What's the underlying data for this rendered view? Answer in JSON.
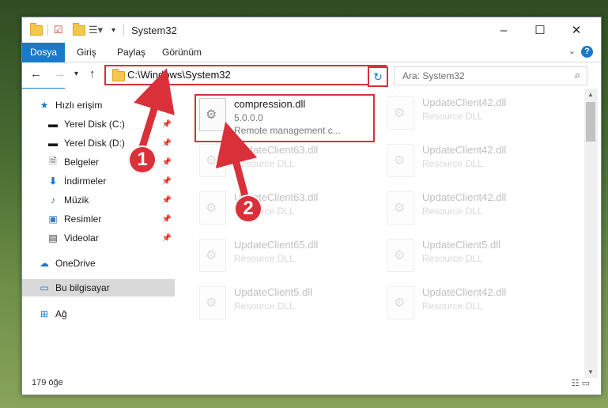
{
  "window": {
    "title": "System32",
    "controls": {
      "minimize": "–",
      "maximize": "☐",
      "close": "✕"
    }
  },
  "ribbon": {
    "tabs": [
      "Dosya",
      "Giriş",
      "Paylaş",
      "Görünüm"
    ],
    "help": "?",
    "collapse": "⌄"
  },
  "address": {
    "path": "C:\\Windows\\System32",
    "search_placeholder": "Ara: System32"
  },
  "nav": {
    "quick_access": "Hızlı erişim",
    "items": [
      "Yerel Disk (C:)",
      "Yerel Disk (D:)",
      "Belgeler",
      "İndirmeler",
      "Müzik",
      "Resimler",
      "Videolar"
    ],
    "onedrive": "OneDrive",
    "this_pc": "Bu bilgisayar",
    "network": "Ağ"
  },
  "files": {
    "selected": {
      "name": "compression.dll",
      "version": "5.0.0.0",
      "description": "Remote management c..."
    },
    "left_column": [
      {
        "name": "UpdateClient63.dll",
        "desc": "Resource DLL"
      },
      {
        "name": "UpdateClient63.dll",
        "desc": "Resource DLL"
      },
      {
        "name": "UpdateClient65.dll",
        "desc": "Resource DLL"
      },
      {
        "name": "UpdateClient5.dll",
        "desc": "Resource DLL"
      }
    ],
    "right_column": [
      {
        "name": "UpdateClient42.dll",
        "desc": "Resource DLL"
      },
      {
        "name": "UpdateClient42.dll",
        "desc": "Resource DLL"
      },
      {
        "name": "UpdateClient42.dll",
        "desc": "Resource DLL"
      },
      {
        "name": "UpdateClient5.dll",
        "desc": "Resource DLL"
      },
      {
        "name": "UpdateClient42.dll",
        "desc": "Resource DLL"
      }
    ]
  },
  "status": {
    "count": "179 öğe"
  },
  "annotations": {
    "badge1": "1",
    "badge2": "2",
    "color": "#d9303a"
  }
}
